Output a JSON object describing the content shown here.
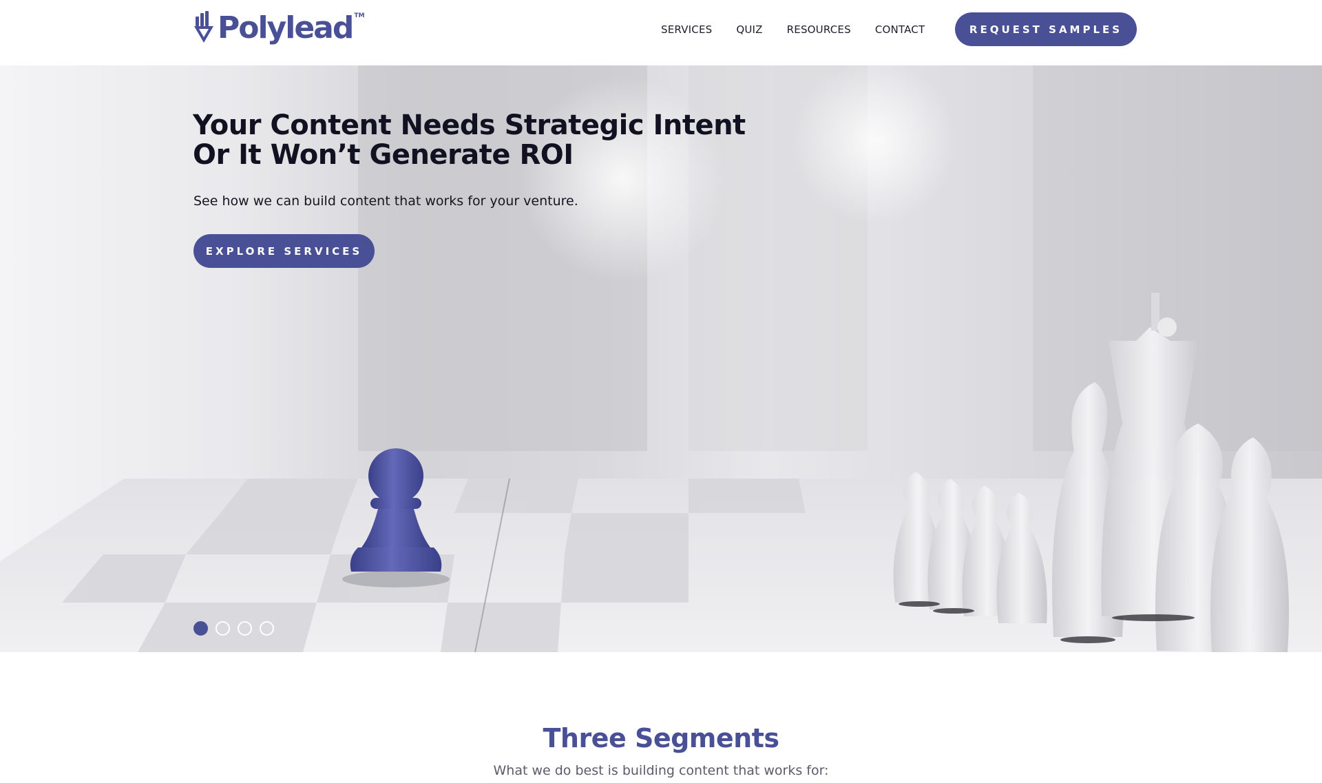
{
  "brand": {
    "name": "Polylead",
    "trademark": "TM",
    "color": "#4a5096"
  },
  "nav": {
    "items": [
      {
        "label": "SERVICES"
      },
      {
        "label": "QUIZ"
      },
      {
        "label": "RESOURCES"
      },
      {
        "label": "CONTACT"
      }
    ],
    "cta_label": "REQUEST SAMPLES"
  },
  "hero": {
    "title": "Your Content Needs Strategic Intent Or It Won’t Generate ROI",
    "subtitle": "See how we can build content that works for your venture.",
    "cta_label": "EXPLORE SERVICES",
    "image": "chessboard-blue-pawn-vs-white-pieces",
    "slides_total": 4,
    "slide_active": 1
  },
  "segments": {
    "title": "Three Segments",
    "subtitle": "What we do best is building content that works for:"
  }
}
